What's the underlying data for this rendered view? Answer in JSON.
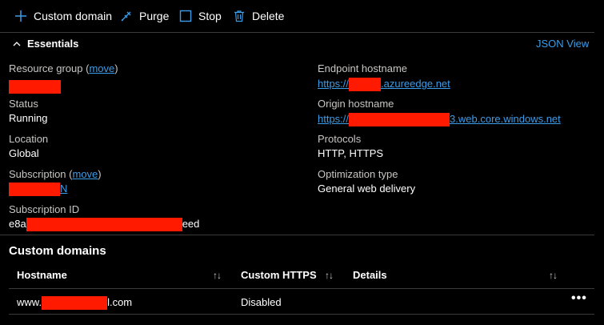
{
  "toolbar": {
    "custom_domain": "Custom domain",
    "purge": "Purge",
    "stop": "Stop",
    "delete": "Delete"
  },
  "essentials": {
    "title": "Essentials",
    "json_view": "JSON View",
    "resource_group": {
      "label": "Resource group",
      "paren_open": " (",
      "move": "move",
      "paren_close": ")"
    },
    "status": {
      "label": "Status",
      "value": "Running"
    },
    "location": {
      "label": "Location",
      "value": "Global"
    },
    "subscription": {
      "label": "Subscription",
      "paren_open": " (",
      "move": "move",
      "paren_close": ")",
      "value_suffix": "N"
    },
    "subscription_id": {
      "label": "Subscription ID",
      "prefix": "e8a",
      "suffix": "eed"
    },
    "endpoint_hostname": {
      "label": "Endpoint hostname",
      "prefix": "https://",
      "suffix": ".azureedge.net"
    },
    "origin_hostname": {
      "label": "Origin hostname",
      "prefix": "https://",
      "suffix": "3.web.core.windows.net"
    },
    "protocols": {
      "label": "Protocols",
      "value": "HTTP, HTTPS"
    },
    "optimization_type": {
      "label": "Optimization type",
      "value": "General web delivery"
    }
  },
  "custom_domains": {
    "title": "Custom domains",
    "columns": [
      "Hostname",
      "Custom HTTPS",
      "Details"
    ],
    "sort_glyph": "↑↓",
    "rows": [
      {
        "host_prefix": "www.",
        "host_suffix": "l.com",
        "https": "Disabled",
        "more": "•••"
      }
    ]
  },
  "colors": {
    "accent": "#3b9ce8",
    "redaction": "#ff1a00",
    "background": "#000000"
  }
}
